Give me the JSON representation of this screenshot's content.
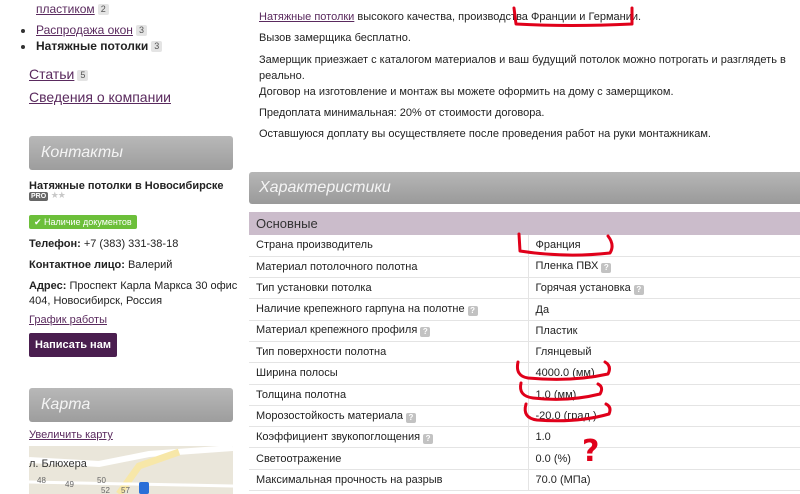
{
  "sidebar": {
    "categories": [
      {
        "label": "пластиком",
        "count": "2"
      },
      {
        "label": "Распродажа окон",
        "count": "3"
      },
      {
        "label": "Натяжные потолки",
        "count": "3"
      }
    ],
    "articles": {
      "label": "Статьи",
      "count": "5"
    },
    "about": {
      "label": "Сведения о компании"
    },
    "contacts": {
      "header": "Контакты",
      "company_name": "Натяжные потолки в Новосибирске",
      "pro": "PRO",
      "stars": "★★",
      "documents_badge": "✔ Наличие документов",
      "phone_label": "Телефон:",
      "phone": "+7 (383) 331-38-18",
      "contact_label": "Контактное лицо:",
      "contact_name": "Валерий",
      "address_label": "Адрес:",
      "address_line1": "Проспект Карла Маркса 30 офис",
      "address_line2": "404, Новосибирск, Россия",
      "schedule_link": "График работы",
      "write_button": "Написать нам"
    },
    "map": {
      "header": "Карта",
      "enlarge_link": "Увеличить карту",
      "street": "л. Блюхера",
      "numbers": [
        "48",
        "49",
        "50",
        "52",
        "57"
      ]
    }
  },
  "main": {
    "intro_link": "Натяжные потолки",
    "intro_rest": " высокого качества, производства Франции и Германии.",
    "paragraphs": [
      "Вызов замерщика бесплатно.",
      "Замерщик приезжает с каталогом материалов и ваш будущий потолок можно потрогать и разглядеть в реально.",
      "Договор на изготовление и монтаж вы можете оформить на дому с замерщиком.",
      "Предоплата минимальная: 20% от стоимости договора.",
      "Оставшуюся доплату вы осуществляете после проведения работ на руки монтажникам."
    ],
    "characteristics_header": "Характеристики",
    "table": {
      "group": "Основные",
      "rows": [
        {
          "name": "Страна производитель",
          "value": "Франция",
          "help_name": false,
          "help_value": false
        },
        {
          "name": "Материал потолочного полотна",
          "value": "Пленка ПВХ",
          "help_name": false,
          "help_value": true
        },
        {
          "name": "Тип установки потолка",
          "value": "Горячая установка",
          "help_name": false,
          "help_value": true
        },
        {
          "name": "Наличие крепежного гарпуна на полотне",
          "value": "Да",
          "help_name": true,
          "help_value": false
        },
        {
          "name": "Материал крепежного профиля",
          "value": "Пластик",
          "help_name": true,
          "help_value": false
        },
        {
          "name": "Тип поверхности полотна",
          "value": "Глянцевый",
          "help_name": false,
          "help_value": false
        },
        {
          "name": "Ширина полосы",
          "value": "4000.0 (мм)",
          "help_name": false,
          "help_value": false
        },
        {
          "name": "Толщина полотна",
          "value": "1.0 (мм)",
          "help_name": false,
          "help_value": false
        },
        {
          "name": "Морозостойкость материала",
          "value": "-20.0 (град.)",
          "help_name": true,
          "help_value": false
        },
        {
          "name": "Коэффициент звукопоглощения",
          "value": "1.0",
          "help_name": true,
          "help_value": false
        },
        {
          "name": "Светоотражение",
          "value": "0.0 (%)",
          "help_name": false,
          "help_value": false
        },
        {
          "name": "Максимальная прочность на разрыв",
          "value": "70.0 (МПа)",
          "help_name": false,
          "help_value": false
        }
      ]
    }
  },
  "annotations": {
    "color": "#e0001a",
    "question_mark": "?"
  }
}
